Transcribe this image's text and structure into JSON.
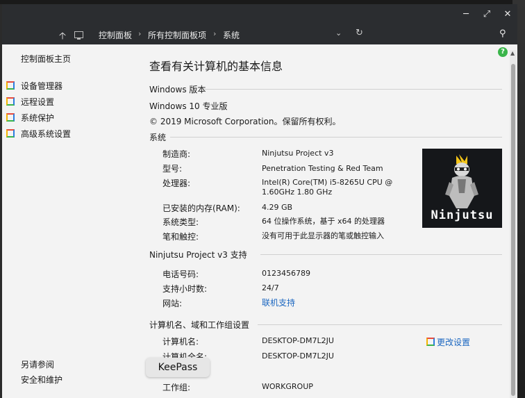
{
  "window": {
    "minimize_icon": "minimize-icon",
    "maximize_icon": "maximize-icon",
    "close_icon": "close-icon"
  },
  "address_bar": {
    "crumbs": [
      "控制面板",
      "所有控制面板项",
      "系统"
    ],
    "separator": "›"
  },
  "left_pane": {
    "home_link": "控制面板主页",
    "items": [
      "设备管理器",
      "远程设置",
      "系统保护",
      "高级系统设置"
    ],
    "see_also": "另请参阅",
    "security": "安全和维护"
  },
  "tooltip": "KeePass",
  "main": {
    "title": "查看有关计算机的基本信息",
    "windows_edition": {
      "heading": "Windows 版本",
      "edition": "Windows 10 专业版",
      "copyright": "© 2019 Microsoft Corporation。保留所有权利。"
    },
    "system": {
      "heading": "系统",
      "rows": [
        {
          "key": "制造商:",
          "value": "Ninjutsu Project v3"
        },
        {
          "key": "型号:",
          "value": "Penetration Testing & Red Team"
        },
        {
          "key": "处理器:",
          "value": "Intel(R) Core(TM) i5-8265U CPU @ 1.60GHz 1.80 GHz"
        },
        {
          "key": "已安装的内存(RAM):",
          "value": "4.29 GB"
        },
        {
          "key": "系统类型:",
          "value": "64 位操作系统，基于 x64 的处理器"
        },
        {
          "key": "笔和触控:",
          "value": "没有可用于此显示器的笔或触控输入"
        }
      ],
      "logo_text": "Ninjutsu"
    },
    "support": {
      "heading": "Ninjutsu Project v3 支持",
      "rows": [
        {
          "key": "电话号码:",
          "value": "0123456789"
        },
        {
          "key": "支持小时数:",
          "value": "24/7"
        },
        {
          "key": "网站:",
          "value": "联机支持"
        }
      ]
    },
    "computer_name": {
      "heading": "计算机名、域和工作组设置",
      "change_settings": "更改设置",
      "rows": [
        {
          "key": "计算机名:",
          "value": "DESKTOP-DM7L2JU"
        },
        {
          "key": "计算机全名:",
          "value": "DESKTOP-DM7L2JU"
        },
        {
          "key": "工作组:",
          "value": "WORKGROUP"
        }
      ]
    }
  },
  "colors": {
    "titlebar": "#2b2d30",
    "window_bg": "#f3f3f3",
    "link": "#1a66c0"
  }
}
